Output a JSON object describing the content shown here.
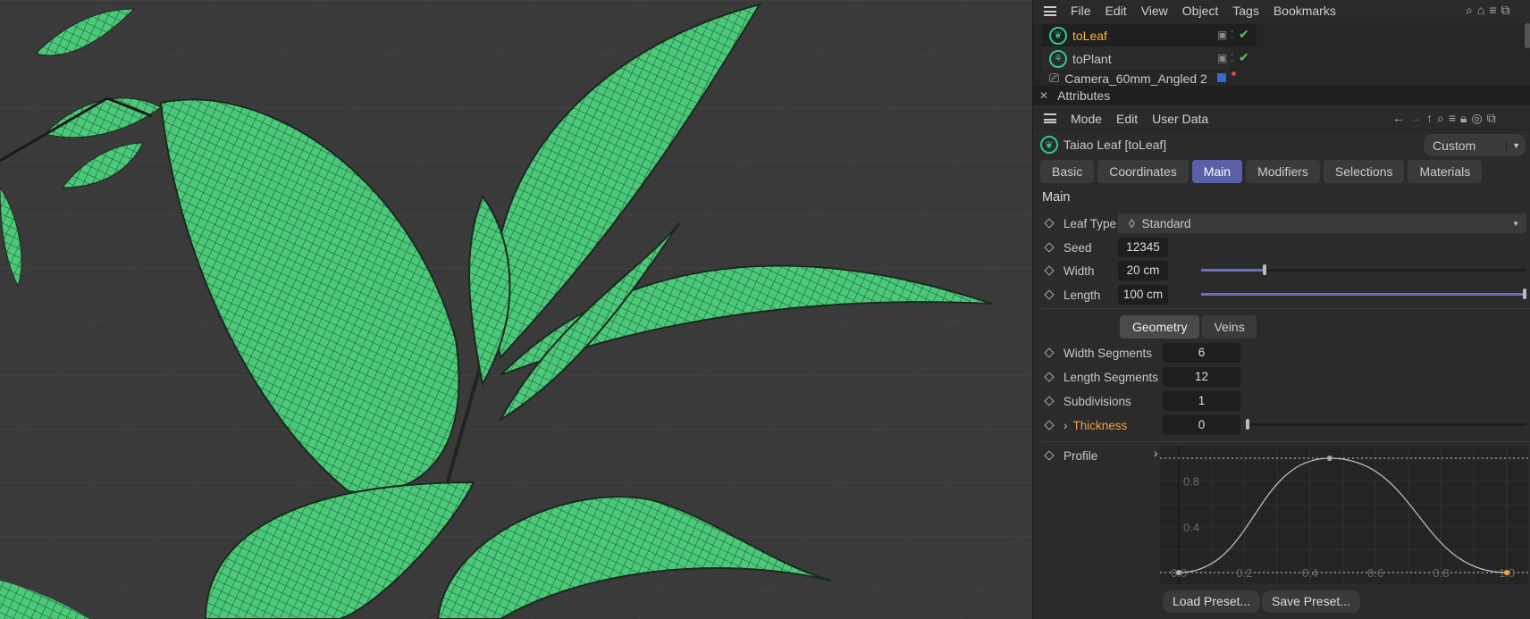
{
  "menubar": {
    "items": [
      "File",
      "Edit",
      "View",
      "Object",
      "Tags",
      "Bookmarks"
    ]
  },
  "objects": [
    {
      "name": "toLeaf",
      "icon": "leaf-icon",
      "selected": true
    },
    {
      "name": "toPlant",
      "icon": "plant-icon",
      "selected": false
    },
    {
      "name": "Camera_60mm_Angled 2",
      "icon": "camera-icon",
      "selected": false
    }
  ],
  "attributes": {
    "title": "Attributes",
    "menu": [
      "Mode",
      "Edit",
      "User Data"
    ],
    "object_title": "Taiao Leaf [toLeaf]",
    "preset": "Custom",
    "tabs": [
      "Basic",
      "Coordinates",
      "Main",
      "Modifiers",
      "Selections",
      "Materials"
    ],
    "active_tab": "Main",
    "section": "Main",
    "leaf_type_label": "Leaf Type",
    "leaf_type": "Standard",
    "seed_label": "Seed",
    "seed": "12345",
    "width_label": "Width",
    "width": "20 cm",
    "width_fraction": 0.2,
    "length_label": "Length",
    "length": "100 cm",
    "length_fraction": 1.0,
    "subtabs": [
      "Geometry",
      "Veins"
    ],
    "width_segments_label": "Width Segments",
    "width_segments": "6",
    "length_segments_label": "Length Segments",
    "length_segments": "12",
    "subdivisions_label": "Subdivisions",
    "subdivisions": "1",
    "thickness_label": "Thickness",
    "thickness": "0",
    "profile_label": "Profile",
    "load_preset": "Load Preset...",
    "save_preset": "Save Preset..."
  },
  "chart_data": {
    "type": "line",
    "title": "Profile",
    "x_ticks": [
      "0.0",
      "0.2",
      "0.4",
      "0.6",
      "0.8",
      "1.0"
    ],
    "y_ticks": [
      "0.4",
      "0.8"
    ],
    "xlim": [
      0,
      1
    ],
    "ylim": [
      0,
      1
    ],
    "points": [
      [
        0,
        0
      ],
      [
        0.46,
        1
      ],
      [
        1,
        0
      ]
    ],
    "curve_color": "#bdbdbd",
    "end_point_color": "#f5a623"
  },
  "colors": {
    "accent": "#5a5fa8",
    "leaf": "#3fc47a",
    "selected_text": "#f0b840",
    "thickness_label": "#f0a040"
  }
}
